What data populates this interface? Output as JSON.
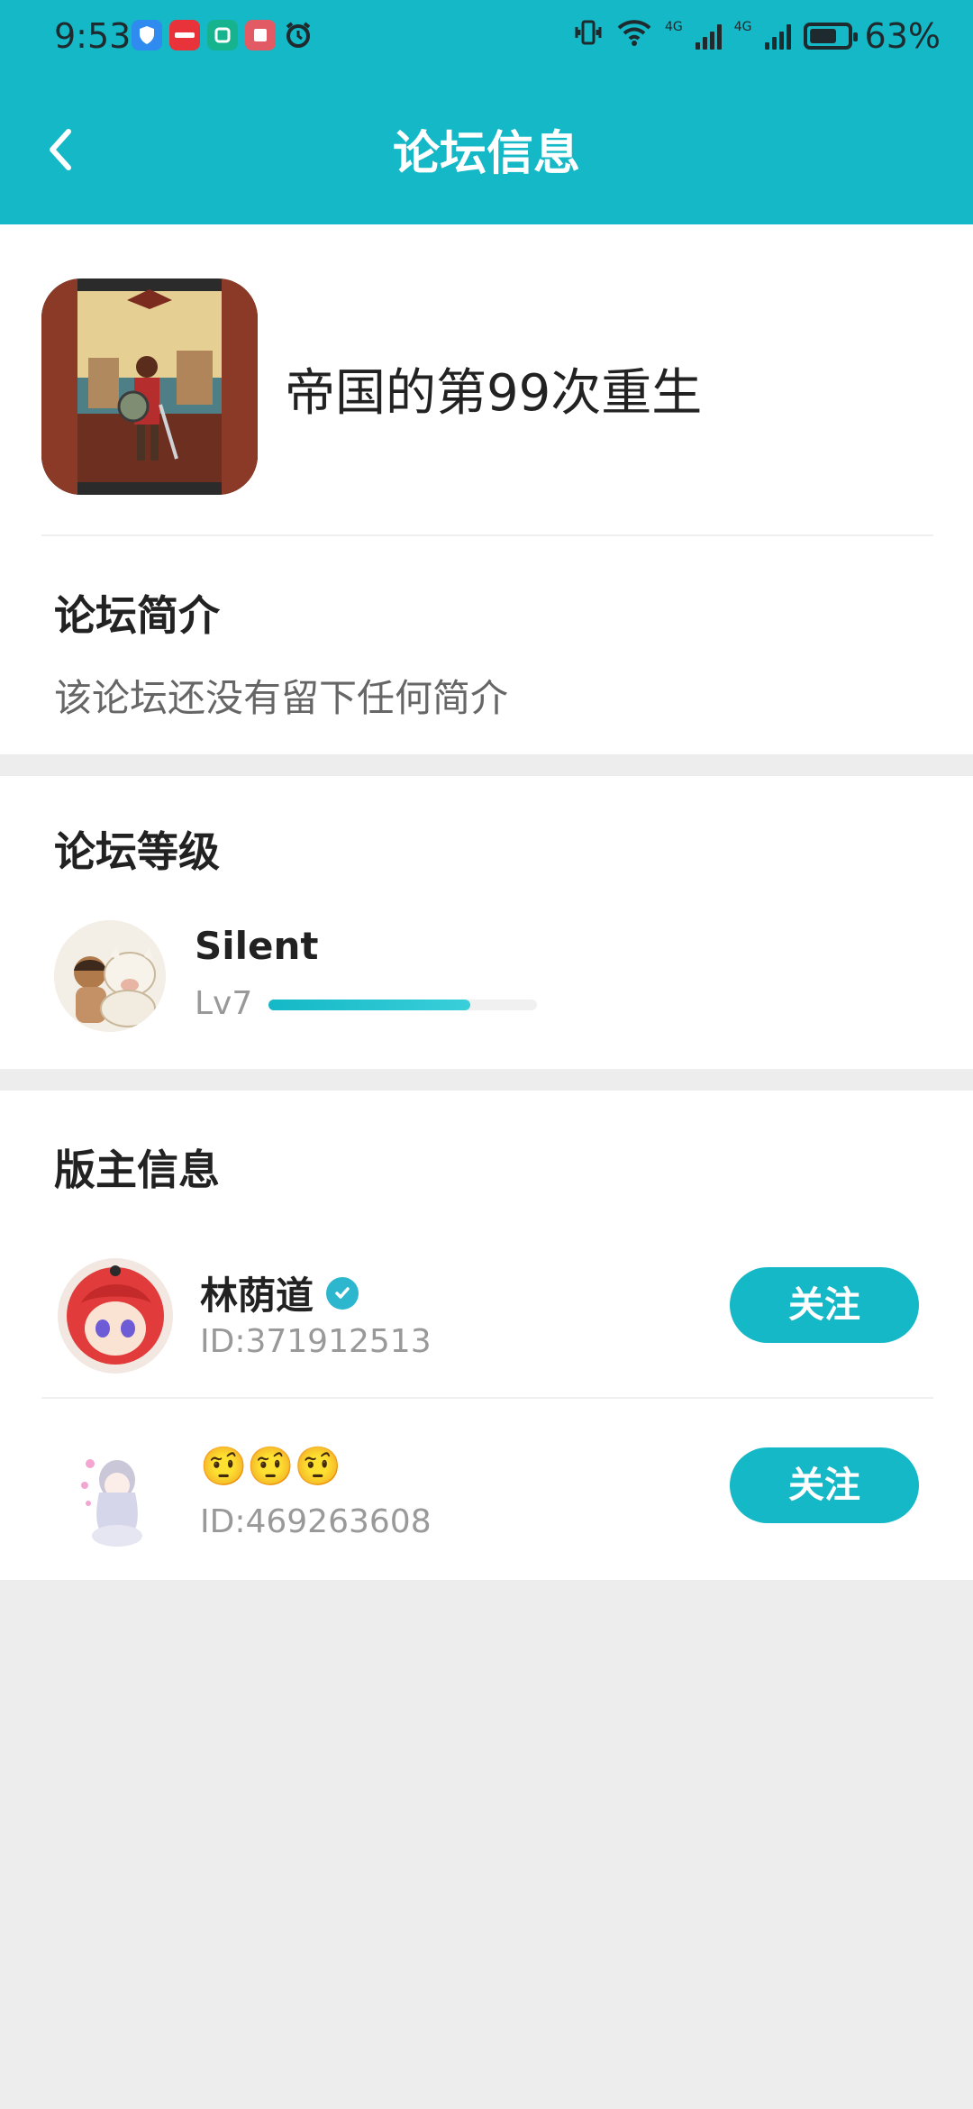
{
  "status_bar": {
    "time": "9:53",
    "battery": "63%",
    "network_labels": [
      "4G",
      "4G"
    ],
    "app_icons": [
      "shield-app-icon",
      "xiaohongshu-icon",
      "mi-icon",
      "reader-icon",
      "alarm-icon"
    ]
  },
  "header": {
    "title": "论坛信息",
    "back_icon": "chevron-left-icon"
  },
  "forum": {
    "name": "帝国的第99次重生",
    "intro_title": "论坛简介",
    "intro_text": "该论坛还没有留下任何简介"
  },
  "level": {
    "section_title": "论坛等级",
    "user_name": "Silent",
    "level_label": "Lv7",
    "progress_fraction": 0.75
  },
  "moderators": {
    "section_title": "版主信息",
    "items": [
      {
        "name": "林荫道",
        "id": "ID:371912513",
        "verified": true,
        "follow_label": "关注"
      },
      {
        "name": "🤨🤨🤨",
        "id": "ID:469263608",
        "verified": false,
        "follow_label": "关注"
      }
    ]
  },
  "colors": {
    "accent": "#14B8C6",
    "background": "#EDEDED",
    "text_primary": "#222222",
    "text_secondary": "#999999"
  }
}
